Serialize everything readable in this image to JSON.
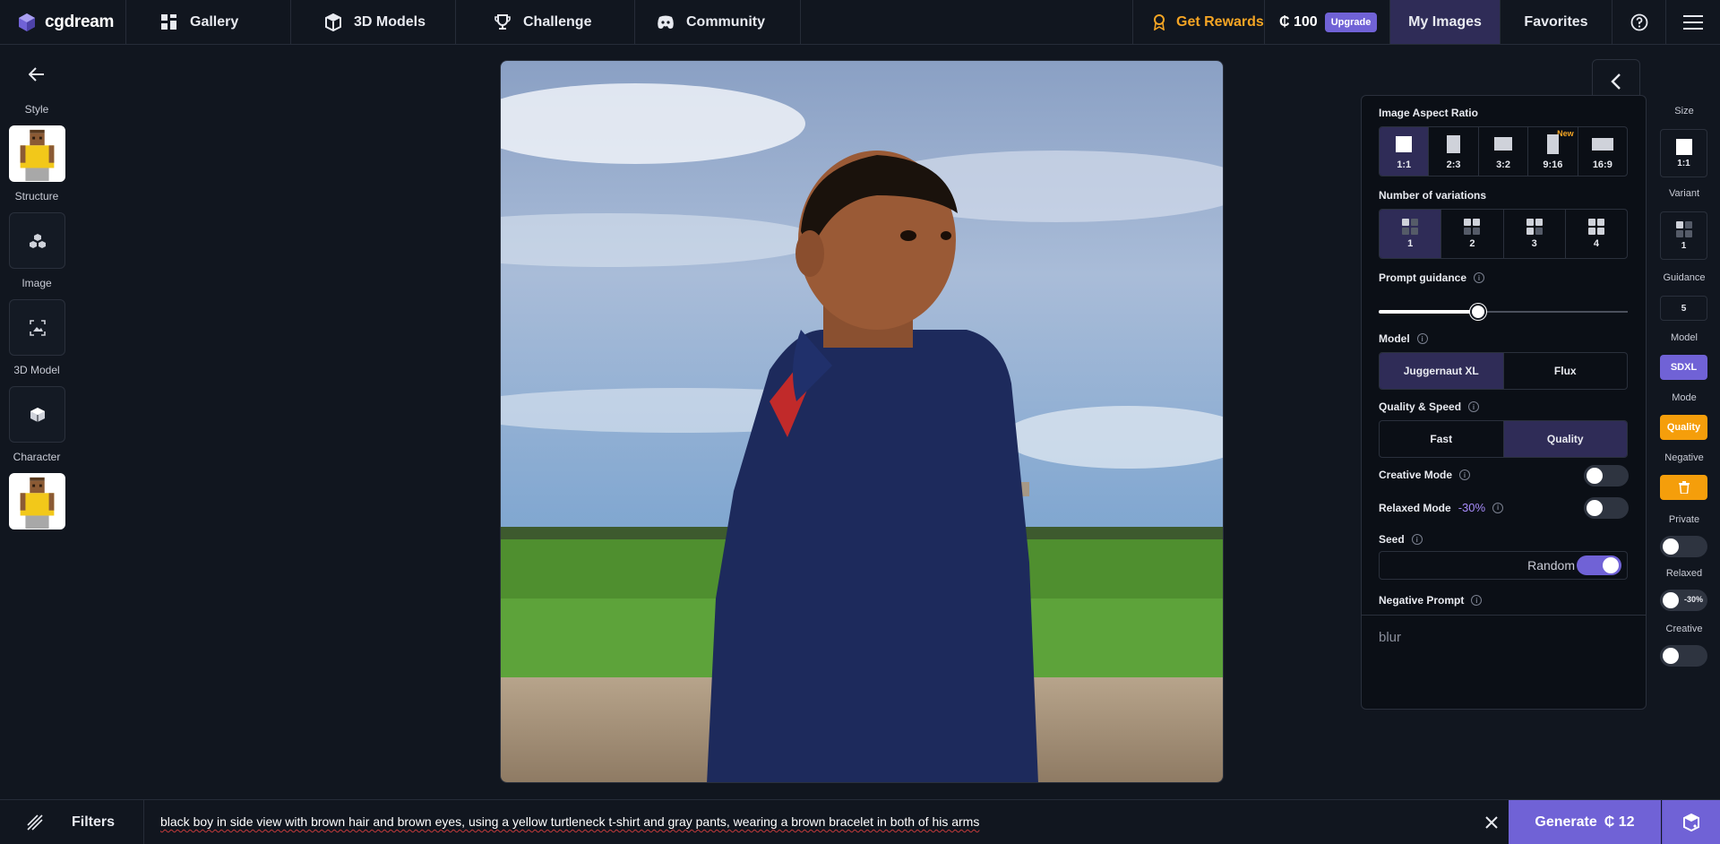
{
  "app": {
    "name": "cgdream"
  },
  "nav": {
    "gallery": "Gallery",
    "models3d": "3D Models",
    "challenge": "Challenge",
    "community": "Community",
    "rewards": "Get Rewards",
    "credits": "₵ 100",
    "upgrade": "Upgrade",
    "my_images": "My Images",
    "favorites": "Favorites"
  },
  "sidebar": {
    "style": "Style",
    "structure": "Structure",
    "image": "Image",
    "model3d": "3D Model",
    "character": "Character"
  },
  "panel": {
    "aspect_title": "Image Aspect Ratio",
    "ratios": [
      {
        "label": "1:1",
        "active": true
      },
      {
        "label": "2:3",
        "active": false
      },
      {
        "label": "3:2",
        "active": false
      },
      {
        "label": "9:16",
        "active": false,
        "badge": "New"
      },
      {
        "label": "16:9",
        "active": false
      }
    ],
    "variations_title": "Number of variations",
    "variations": [
      {
        "label": "1",
        "active": true
      },
      {
        "label": "2",
        "active": false
      },
      {
        "label": "3",
        "active": false
      },
      {
        "label": "4",
        "active": false
      }
    ],
    "guidance_title": "Prompt guidance",
    "guidance_value": 0.4,
    "model_title": "Model",
    "models": [
      "Juggernaut XL",
      "Flux"
    ],
    "quality_title": "Quality & Speed",
    "quality_options": [
      "Fast",
      "Quality"
    ],
    "creative_mode": "Creative Mode",
    "relaxed_mode": "Relaxed Mode",
    "relaxed_pct": "-30%",
    "seed_title": "Seed",
    "seed_random": "Random",
    "negative_title": "Negative Prompt",
    "negative_text": "blur"
  },
  "rightcol": {
    "size": "Size",
    "size_value": "1:1",
    "variant": "Variant",
    "variant_value": "1",
    "guidance": "Guidance",
    "guidance_value": "5",
    "model": "Model",
    "model_value": "SDXL",
    "mode": "Mode",
    "mode_value": "Quality",
    "negative": "Negative",
    "private": "Private",
    "relaxed": "Relaxed",
    "relaxed_pct": "-30%",
    "creative": "Creative"
  },
  "bottom": {
    "filters": "Filters",
    "prompt": "black boy in side view with brown hair and brown eyes, using a yellow turtleneck t-shirt and gray pants, wearing a brown bracelet in both of his arms",
    "generate": "Generate",
    "generate_cost": "₵ 12"
  },
  "colors": {
    "accent": "#7062d6",
    "active_bg": "#2f2c57",
    "orange": "#f5a524",
    "bg": "#11161f"
  }
}
